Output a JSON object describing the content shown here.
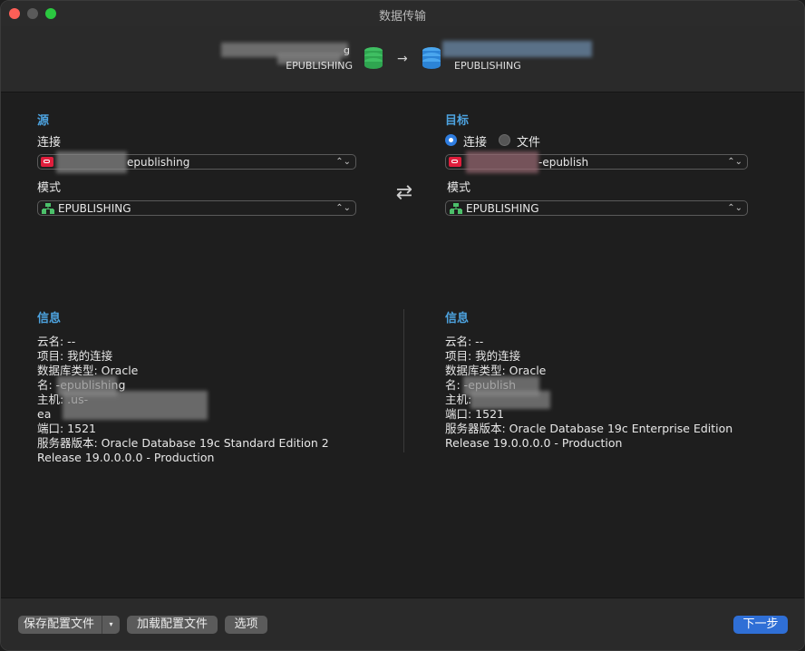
{
  "window": {
    "title": "数据传输"
  },
  "header": {
    "source_name_suffix": "g",
    "source_schema": "EPUBLISHING",
    "target_schema": "EPUBLISHING",
    "arrow": "→"
  },
  "source": {
    "title": "源",
    "connection_label": "连接",
    "connection_value": "epublishing",
    "schema_label": "模式",
    "schema_value": "EPUBLISHING"
  },
  "target": {
    "title": "目标",
    "radio_connection": "连接",
    "radio_file": "文件",
    "connection_value": "-epublish",
    "schema_label": "模式",
    "schema_value": "EPUBLISHING"
  },
  "swap_icon": "⇄",
  "source_info": {
    "title": "信息",
    "lines": [
      "云名: --",
      "项目: 我的连接",
      "数据库类型: Oracle",
      "名:        -epublishing",
      "主机:                    .us-",
      "ea",
      "端口: 1521",
      "服务器版本: Oracle Database 19c Standard Edition 2",
      "Release 19.0.0.0.0 - Production"
    ]
  },
  "target_info": {
    "title": "信息",
    "lines": [
      "云名: --",
      "项目: 我的连接",
      "数据库类型: Oracle",
      "名:             -epublish",
      "主机:",
      "端口: 1521",
      "服务器版本: Oracle Database 19c Enterprise Edition",
      "Release 19.0.0.0.0 - Production"
    ]
  },
  "footer": {
    "save_profile": "保存配置文件",
    "save_dropdown": "▾",
    "load_profile": "加载配置文件",
    "options": "选项",
    "next": "下一步"
  },
  "colors": {
    "accent": "#4da3e0",
    "primary_button": "#2f6fd6",
    "oracle_red": "#e01e3c"
  },
  "icons": {
    "source_db": "green-database-icon",
    "target_db": "blue-database-icon",
    "connection": "oracle-icon",
    "schema": "schema-icon"
  }
}
